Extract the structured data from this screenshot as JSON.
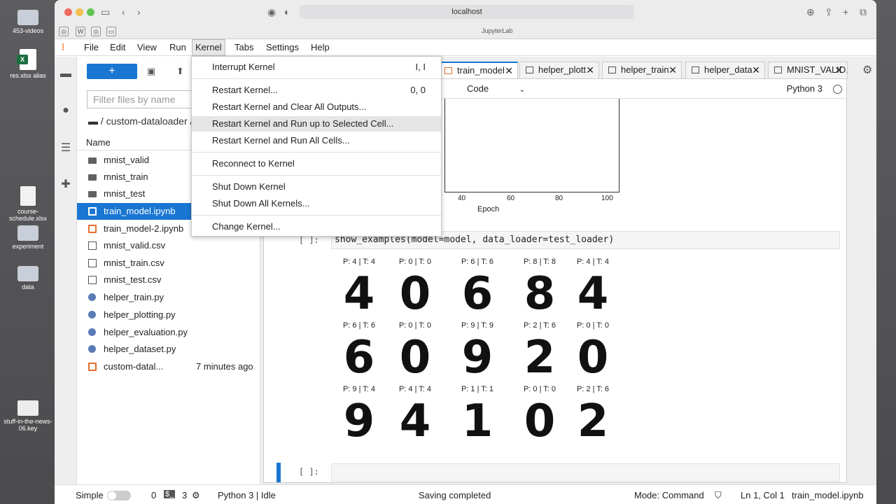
{
  "desktop": {
    "icons": [
      {
        "label": "453-videos"
      },
      {
        "label": "res.xlsx alias"
      },
      {
        "label": "course-schedule.xlsx"
      },
      {
        "label": "experiment"
      },
      {
        "label": "data"
      },
      {
        "label": "stuff-in-the-news-06.key"
      }
    ]
  },
  "browser": {
    "url": "localhost",
    "page_title": "JupyterLab"
  },
  "menu": {
    "items": [
      "File",
      "Edit",
      "View",
      "Run",
      "Kernel",
      "Tabs",
      "Settings",
      "Help"
    ],
    "active": "Kernel"
  },
  "kernel_menu": {
    "groups": [
      [
        {
          "label": "Interrupt Kernel",
          "shortcut": "I, I"
        }
      ],
      [
        {
          "label": "Restart Kernel...",
          "shortcut": "0, 0"
        },
        {
          "label": "Restart Kernel and Clear All Outputs...",
          "shortcut": ""
        },
        {
          "label": "Restart Kernel and Run up to Selected Cell...",
          "shortcut": ""
        },
        {
          "label": "Restart Kernel and Run All Cells...",
          "shortcut": ""
        }
      ],
      [
        {
          "label": "Reconnect to Kernel",
          "shortcut": ""
        }
      ],
      [
        {
          "label": "Shut Down Kernel",
          "shortcut": ""
        },
        {
          "label": "Shut Down All Kernels...",
          "shortcut": ""
        }
      ],
      [
        {
          "label": "Change Kernel...",
          "shortcut": ""
        }
      ]
    ],
    "hovered": "Restart Kernel and Run up to Selected Cell..."
  },
  "filebrowser": {
    "new_button": "+",
    "filter_placeholder": "Filter files by name",
    "breadcrumb": "/ custom-dataloader /",
    "column_name": "Name",
    "files": [
      {
        "name": "mnist_valid",
        "type": "folder",
        "modified": ""
      },
      {
        "name": "mnist_train",
        "type": "folder",
        "modified": ""
      },
      {
        "name": "mnist_test",
        "type": "folder",
        "modified": ""
      },
      {
        "name": "train_model.ipynb",
        "type": "notebook",
        "modified": "",
        "selected": true
      },
      {
        "name": "train_model-2.ipynb",
        "type": "notebook",
        "modified": ""
      },
      {
        "name": "mnist_valid.csv",
        "type": "csv",
        "modified": ""
      },
      {
        "name": "mnist_train.csv",
        "type": "csv",
        "modified": ""
      },
      {
        "name": "mnist_test.csv",
        "type": "csv",
        "modified": ""
      },
      {
        "name": "helper_train.py",
        "type": "py",
        "modified": ""
      },
      {
        "name": "helper_plotting.py",
        "type": "py",
        "modified": ""
      },
      {
        "name": "helper_evaluation.py",
        "type": "py",
        "modified": ""
      },
      {
        "name": "helper_dataset.py",
        "type": "py",
        "modified": ""
      },
      {
        "name": "custom-datal...",
        "type": "notebook",
        "modified": "7 minutes ago"
      }
    ]
  },
  "tabs": [
    {
      "label": "train_model",
      "active": true
    },
    {
      "label": "helper_plott",
      "active": false
    },
    {
      "label": "helper_train",
      "active": false
    },
    {
      "label": "helper_data",
      "active": false
    },
    {
      "label": "MNIST_VALID.",
      "active": false
    }
  ],
  "notebook": {
    "cell_type": "Code",
    "kernel": "Python 3",
    "plot": {
      "xlabel": "Epoch",
      "xticks": [
        "40",
        "60",
        "80",
        "100"
      ]
    },
    "code_prompt": "[ ]:",
    "code": "show_examples(model=model, data_loader=test_loader)",
    "examples": [
      {
        "label": "P: 4 | T: 4",
        "digit": "4"
      },
      {
        "label": "P: 0 | T: 0",
        "digit": "0"
      },
      {
        "label": "P: 6 | T: 6",
        "digit": "6"
      },
      {
        "label": "P: 8 | T: 8",
        "digit": "8"
      },
      {
        "label": "P: 4 | T: 4",
        "digit": "4"
      },
      {
        "label": "P: 6 | T: 6",
        "digit": "6"
      },
      {
        "label": "P: 0 | T: 0",
        "digit": "0"
      },
      {
        "label": "P: 9 | T: 9",
        "digit": "9"
      },
      {
        "label": "P: 2 | T: 6",
        "digit": "2"
      },
      {
        "label": "P: 0 | T: 0",
        "digit": "0"
      },
      {
        "label": "P: 9 | T: 4",
        "digit": "9"
      },
      {
        "label": "P: 4 | T: 4",
        "digit": "4"
      },
      {
        "label": "P: 1 | T: 1",
        "digit": "1"
      },
      {
        "label": "P: 0 | T: 0",
        "digit": "0"
      },
      {
        "label": "P: 2 | T: 6",
        "digit": "2"
      }
    ],
    "empty_prompt": "[ ]:"
  },
  "statusbar": {
    "mode_simple": "Simple",
    "count_a": "0",
    "count_b": "3",
    "kernel_status": "Python 3 | Idle",
    "save_status": "Saving completed",
    "mode": "Mode: Command",
    "position": "Ln 1, Col 1",
    "filename": "train_model.ipynb"
  },
  "colors": {
    "accent": "#1976d2",
    "notebook_icon": "#e46e2e"
  }
}
